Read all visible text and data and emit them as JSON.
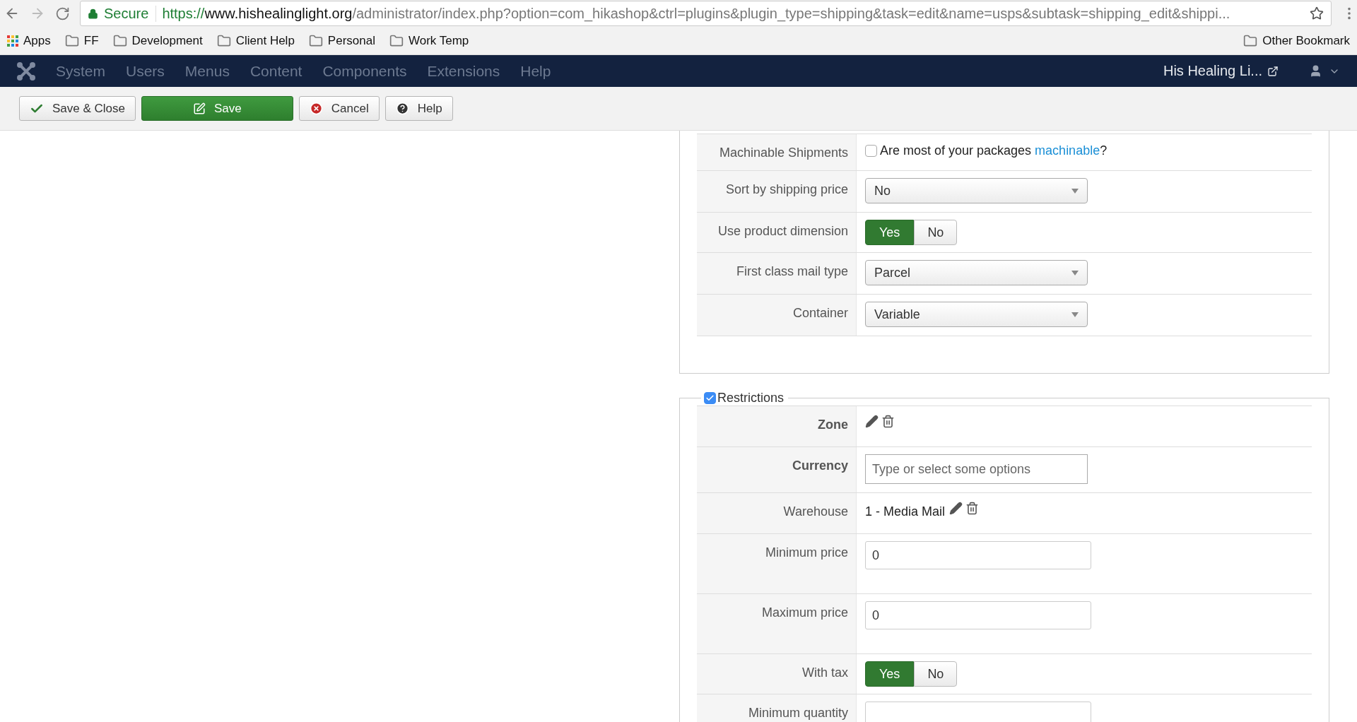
{
  "browser": {
    "secure_label": "Secure",
    "url_scheme": "https://",
    "url_host": "www.hishealinglight.org",
    "url_path": "/administrator/index.php?option=com_hikashop&ctrl=plugins&plugin_type=shipping&task=edit&name=usps&subtask=shipping_edit&shippi...",
    "bookmarks": [
      {
        "label": "Apps",
        "kind": "apps"
      },
      {
        "label": "FF",
        "kind": "folder"
      },
      {
        "label": "Development",
        "kind": "folder"
      },
      {
        "label": "Client Help",
        "kind": "folder"
      },
      {
        "label": "Personal",
        "kind": "folder"
      },
      {
        "label": "Work Temp",
        "kind": "folder"
      }
    ],
    "other_bookmarks": "Other Bookmark"
  },
  "nav": {
    "menu": [
      "System",
      "Users",
      "Menus",
      "Content",
      "Components",
      "Extensions",
      "Help"
    ],
    "site_link": "His Healing Li..."
  },
  "toolbar": [
    {
      "label": "Save & Close",
      "kind": "check",
      "primary": false
    },
    {
      "label": "Save",
      "kind": "edit",
      "primary": true
    },
    {
      "label": "Cancel",
      "kind": "cancel",
      "primary": false
    },
    {
      "label": "Help",
      "kind": "help",
      "primary": false
    }
  ],
  "shipping_section": {
    "rows": [
      {
        "label": "Machinable Shipments",
        "bold": false,
        "kind": "checkbox",
        "checked": false,
        "text_before": "Are most of your packages ",
        "link": "machinable",
        "text_after": "?"
      },
      {
        "label": "Sort by shipping price",
        "bold": false,
        "kind": "select",
        "value": "No"
      },
      {
        "label": "Use product dimension",
        "bold": false,
        "kind": "toggle",
        "options": [
          {
            "label": "Yes",
            "selected": true
          },
          {
            "label": "No",
            "selected": false
          }
        ]
      },
      {
        "label": "First class mail type",
        "bold": false,
        "kind": "select",
        "value": "Parcel"
      },
      {
        "label": "Container",
        "bold": false,
        "kind": "select",
        "value": "Variable"
      }
    ]
  },
  "restrictions": {
    "legend": "Restrictions",
    "checked": true,
    "rows": [
      {
        "label": "Zone",
        "bold": true,
        "kind": "actions"
      },
      {
        "label": "Currency",
        "bold": true,
        "kind": "multiselect",
        "placeholder": "Type or select some options"
      },
      {
        "label": "Warehouse",
        "bold": false,
        "kind": "actions",
        "value": "1 - Media Mail"
      },
      {
        "label": "Minimum price",
        "bold": false,
        "kind": "input",
        "value": "0"
      },
      {
        "label": "Maximum price",
        "bold": false,
        "kind": "input",
        "value": "0"
      },
      {
        "label": "With tax",
        "bold": false,
        "kind": "toggle",
        "options": [
          {
            "label": "Yes",
            "selected": true
          },
          {
            "label": "No",
            "selected": false
          }
        ]
      },
      {
        "label": "Minimum quantity",
        "bold": false,
        "kind": "input"
      }
    ]
  }
}
